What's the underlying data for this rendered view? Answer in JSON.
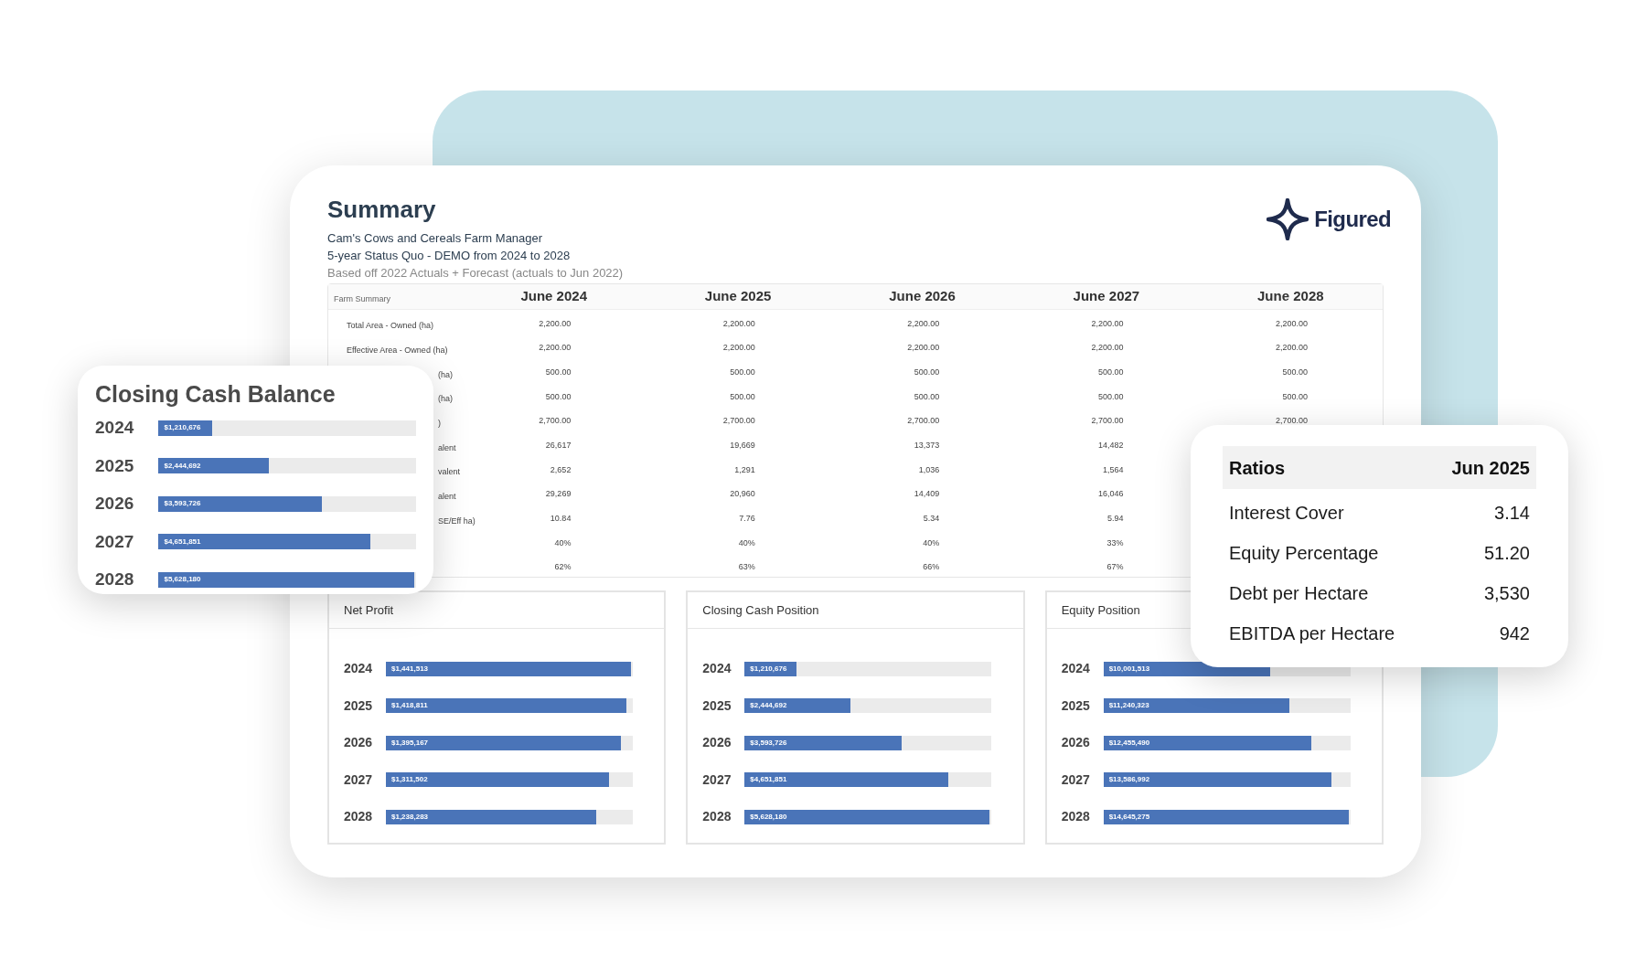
{
  "summary": {
    "title": "Summary",
    "lines": [
      "Cam's Cows and Cereals Farm Manager",
      "5-year Status Quo - DEMO from 2024 to 2028"
    ],
    "note": "Based off 2022 Actuals + Forecast (actuals to Jun 2022)"
  },
  "logo": {
    "text": "Figured"
  },
  "table": {
    "corner": "Farm Summary",
    "columns": [
      "June 2024",
      "June 2025",
      "June 2026",
      "June 2027",
      "June 2028"
    ],
    "rows": [
      {
        "kind": "full",
        "label": "Total Area - Owned (ha)",
        "values": [
          "2,200.00",
          "2,200.00",
          "2,200.00",
          "2,200.00",
          "2,200.00"
        ]
      },
      {
        "kind": "full",
        "label": "Effective Area - Owned (ha)",
        "values": [
          "2,200.00",
          "2,200.00",
          "2,200.00",
          "2,200.00",
          "2,200.00"
        ]
      },
      {
        "kind": "partial",
        "label": "(ha)",
        "values": [
          "500.00",
          "500.00",
          "500.00",
          "500.00",
          "500.00"
        ]
      },
      {
        "kind": "partial",
        "label": "(ha)",
        "values": [
          "500.00",
          "500.00",
          "500.00",
          "500.00",
          "500.00"
        ]
      },
      {
        "kind": "partial",
        "label": ")",
        "values": [
          "2,700.00",
          "2,700.00",
          "2,700.00",
          "2,700.00",
          "2,700.00"
        ]
      },
      {
        "kind": "partial",
        "label": "alent",
        "values": [
          "26,617",
          "19,669",
          "13,373",
          "14,482"
        ]
      },
      {
        "kind": "partial",
        "label": "valent",
        "values": [
          "2,652",
          "1,291",
          "1,036",
          "1,564"
        ]
      },
      {
        "kind": "partial",
        "label": "alent",
        "values": [
          "29,269",
          "20,960",
          "14,409",
          "16,046"
        ]
      },
      {
        "kind": "partial",
        "label": "SE/Eff ha)",
        "values": [
          "10.84",
          "7.76",
          "5.34",
          "5.94"
        ]
      },
      {
        "kind": "hidden",
        "values": [
          "40%",
          "40%",
          "40%",
          "33%"
        ]
      },
      {
        "kind": "hidden",
        "values": [
          "62%",
          "63%",
          "66%",
          "67%"
        ]
      }
    ]
  },
  "panels": [
    {
      "title": "Net Profit",
      "bars": [
        {
          "year": "2024",
          "value": "$1,441,513",
          "level": 1.0
        },
        {
          "year": "2025",
          "value": "$1,418,811",
          "level": 0.98
        },
        {
          "year": "2026",
          "value": "$1,395,167",
          "level": 0.96
        },
        {
          "year": "2027",
          "value": "$1,311,502",
          "level": 0.91
        },
        {
          "year": "2028",
          "value": "$1,238,283",
          "level": 0.86
        }
      ]
    },
    {
      "title": "Closing Cash Position",
      "bars": [
        {
          "year": "2024",
          "value": "$1,210,676",
          "level": 0.21
        },
        {
          "year": "2025",
          "value": "$2,444,692",
          "level": 0.43
        },
        {
          "year": "2026",
          "value": "$3,593,726",
          "level": 0.64
        },
        {
          "year": "2027",
          "value": "$4,651,851",
          "level": 0.83
        },
        {
          "year": "2028",
          "value": "$5,628,180",
          "level": 1.0
        }
      ]
    },
    {
      "title": "Equity Position",
      "bars": [
        {
          "year": "2024",
          "value": "$10,001,513",
          "level": 0.68
        },
        {
          "year": "2025",
          "value": "$11,240,323",
          "level": 0.76
        },
        {
          "year": "2026",
          "value": "$12,455,490",
          "level": 0.85
        },
        {
          "year": "2027",
          "value": "$13,586,992",
          "level": 0.93
        },
        {
          "year": "2028",
          "value": "$14,645,275",
          "level": 1.0
        }
      ]
    }
  ],
  "cash_card": {
    "title": "Closing Cash Balance",
    "bars": [
      {
        "year": "2024",
        "value": "$1,210,676",
        "level": 0.21
      },
      {
        "year": "2025",
        "value": "$2,444,692",
        "level": 0.43
      },
      {
        "year": "2026",
        "value": "$3,593,726",
        "level": 0.64
      },
      {
        "year": "2027",
        "value": "$4,651,851",
        "level": 0.83
      },
      {
        "year": "2028",
        "value": "$5,628,180",
        "level": 1.0
      }
    ]
  },
  "ratios": {
    "columns": [
      "Ratios",
      "Jun 2025"
    ],
    "rows": [
      {
        "label": "Interest Cover",
        "value": "3.14"
      },
      {
        "label": "Equity Percentage",
        "value": "51.20"
      },
      {
        "label": "Debt per Hectare",
        "value": "3,530"
      },
      {
        "label": "EBITDA per Hectare",
        "value": "942"
      }
    ]
  }
}
